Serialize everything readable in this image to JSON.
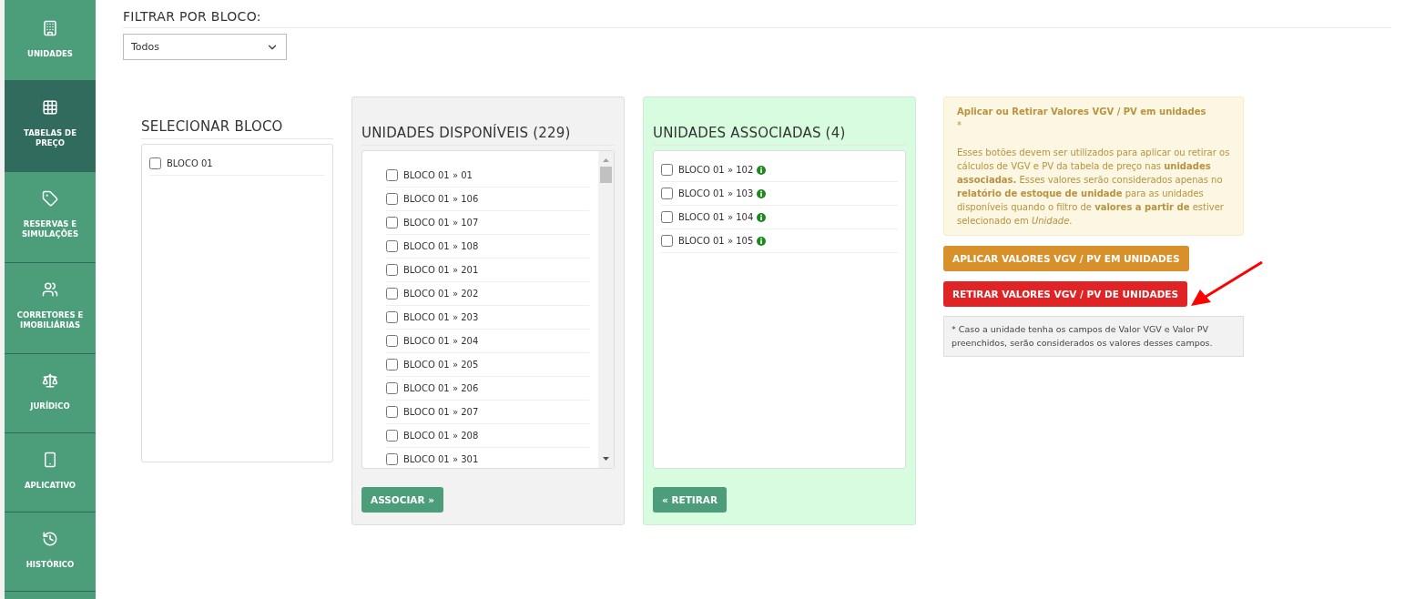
{
  "sidebar": {
    "items": [
      {
        "label": "UNIDADES",
        "selected": false
      },
      {
        "label": "TABELAS DE PREÇO",
        "selected": true
      },
      {
        "label": "RESERVAS E SIMULAÇÕES",
        "selected": false
      },
      {
        "label": "CORRETORES E IMOBILIÁRIAS",
        "selected": false
      },
      {
        "label": "JURÍDICO",
        "selected": false
      },
      {
        "label": "APLICATIVO",
        "selected": false
      },
      {
        "label": "HISTÓRICO",
        "selected": false
      }
    ]
  },
  "filter": {
    "title": "FILTRAR POR BLOCO:",
    "select_value": "Todos"
  },
  "blocks": {
    "title": "SELECIONAR BLOCO",
    "items": [
      {
        "label": "BLOCO 01",
        "checked": false
      }
    ]
  },
  "available": {
    "title": "UNIDADES DISPONÍVEIS (229)",
    "button": "ASSOCIAR »",
    "items": [
      {
        "label": "BLOCO 01 » 01",
        "checked": false
      },
      {
        "label": "BLOCO 01 » 106",
        "checked": false
      },
      {
        "label": "BLOCO 01 » 107",
        "checked": false
      },
      {
        "label": "BLOCO 01 » 108",
        "checked": false
      },
      {
        "label": "BLOCO 01 » 201",
        "checked": false
      },
      {
        "label": "BLOCO 01 » 202",
        "checked": false
      },
      {
        "label": "BLOCO 01 » 203",
        "checked": false
      },
      {
        "label": "BLOCO 01 » 204",
        "checked": false
      },
      {
        "label": "BLOCO 01 » 205",
        "checked": false
      },
      {
        "label": "BLOCO 01 » 206",
        "checked": false
      },
      {
        "label": "BLOCO 01 » 207",
        "checked": false
      },
      {
        "label": "BLOCO 01 » 208",
        "checked": false
      },
      {
        "label": "BLOCO 01 » 301",
        "checked": false
      }
    ]
  },
  "associated": {
    "title": "UNIDADES ASSOCIADAS (4)",
    "button": "« RETIRAR",
    "items": [
      {
        "label": "BLOCO 01 » 102",
        "checked": false
      },
      {
        "label": "BLOCO 01 » 103",
        "checked": false
      },
      {
        "label": "BLOCO 01 » 104",
        "checked": false
      },
      {
        "label": "BLOCO 01 » 105",
        "checked": false
      }
    ]
  },
  "notice": {
    "title": "Aplicar ou Retirar Valores VGV / PV em unidades",
    "mark": "*",
    "body": "Esses botões devem ser utilizados para aplicar ou retirar os cálculos de VGV e PV da tabela de preço nas **unidades associadas.** Esses valores serão considerados apenas no **relatório de estoque de unidade** para as unidades disponíveis quando o filtro de **valores a partir de** estiver selecionado em *Unidade*."
  },
  "actions": [
    {
      "label": "APLICAR VALORES VGV / PV EM UNIDADES",
      "kind": "apply"
    },
    {
      "label": "RETIRAR VALORES VGV / PV DE UNIDADES",
      "kind": "remove"
    }
  ],
  "footnote": "* Caso a unidade tenha os campos de Valor VGV e Valor PV preenchidos, serão considerados os valores desses campos."
}
